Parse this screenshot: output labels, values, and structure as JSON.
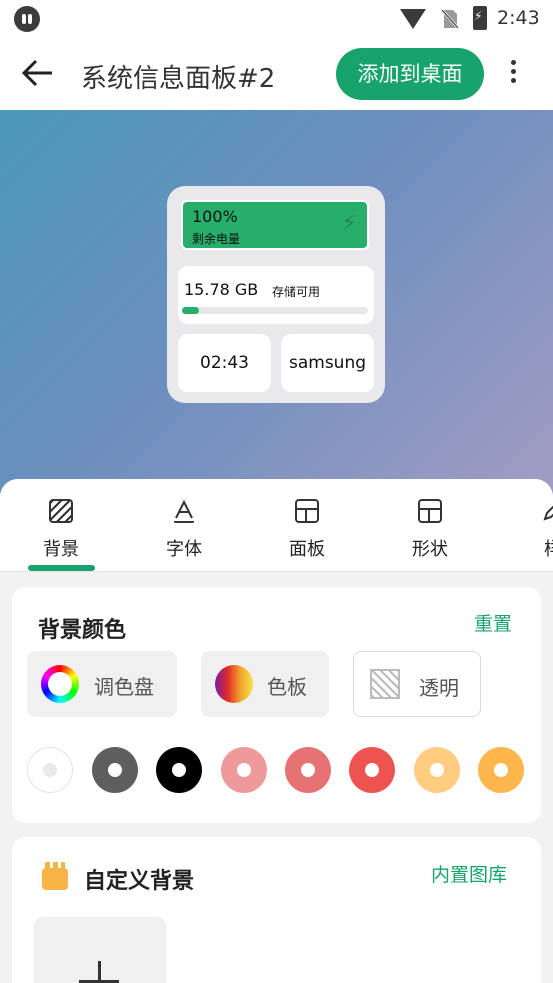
{
  "status_bar": {
    "time": "2:43"
  },
  "toolbar": {
    "title": "系统信息面板#2",
    "add_button": "添加到桌面"
  },
  "widget": {
    "battery_percent": "100%",
    "battery_label": "剩余电量",
    "storage_value": "15.78 GB",
    "storage_label": "存储可用",
    "storage_used_fraction": 0.09,
    "clock": "02:43",
    "device_name": "samsung"
  },
  "tabs": [
    {
      "label": "背景",
      "icon": "background-icon",
      "active": true
    },
    {
      "label": "字体",
      "icon": "font-icon",
      "active": false
    },
    {
      "label": "面板",
      "icon": "panel-icon",
      "active": false
    },
    {
      "label": "形状",
      "icon": "shape-icon",
      "active": false
    },
    {
      "label": "样",
      "icon": "style-icon",
      "active": false
    }
  ],
  "background_color": {
    "title": "背景颜色",
    "reset": "重置",
    "options": [
      {
        "label": "调色盘",
        "icon": "color-wheel-icon"
      },
      {
        "label": "色板",
        "icon": "color-grid-icon"
      },
      {
        "label": "透明",
        "icon": "transparent-icon"
      }
    ],
    "swatches": [
      "#ffffff",
      "#5e5e5e",
      "#000000",
      "#ef9a9a",
      "#e57373",
      "#ef5350",
      "#ffcc80",
      "#ffb74d"
    ]
  },
  "custom_background": {
    "title": "自定义背景",
    "library_link": "内置图库"
  }
}
